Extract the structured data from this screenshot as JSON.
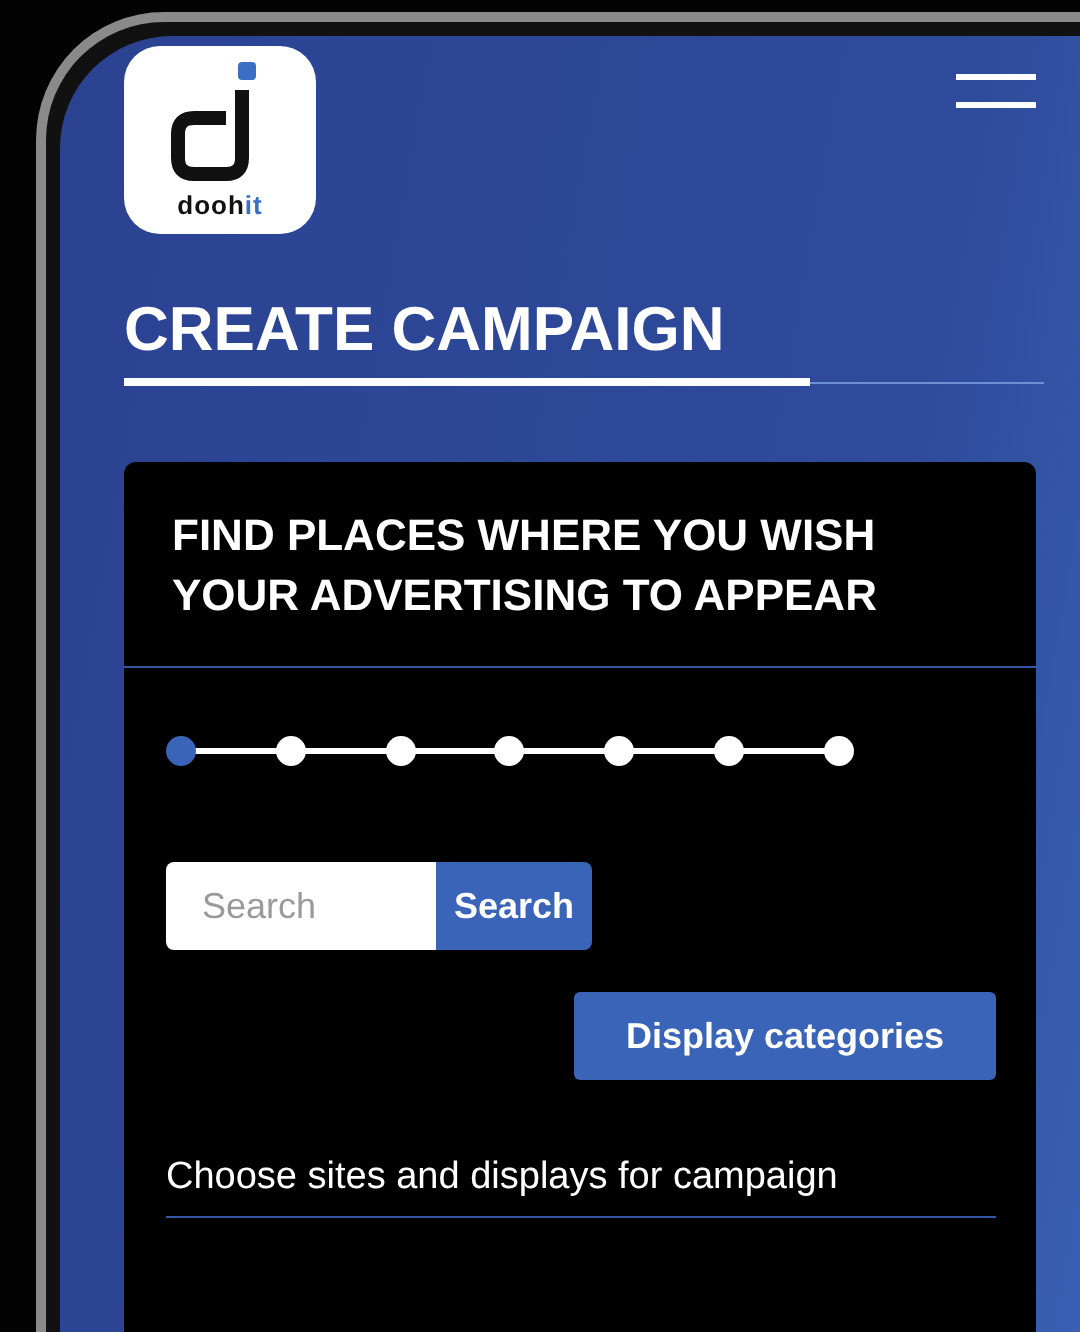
{
  "logo": {
    "text": "dooh",
    "accent": "it"
  },
  "title": "CREATE CAMPAIGN",
  "card": {
    "heading": "FIND PLACES WHERE YOU WISH YOUR ADVERTISING TO APPEAR",
    "steps": [
      {
        "selected": true
      },
      {
        "selected": false
      },
      {
        "selected": false
      },
      {
        "selected": false
      },
      {
        "selected": false
      },
      {
        "selected": false
      },
      {
        "selected": false
      }
    ],
    "search": {
      "placeholder": "Search",
      "button": "Search"
    },
    "categories_button": "Display categories",
    "section_label": "Choose sites and displays for campaign"
  }
}
